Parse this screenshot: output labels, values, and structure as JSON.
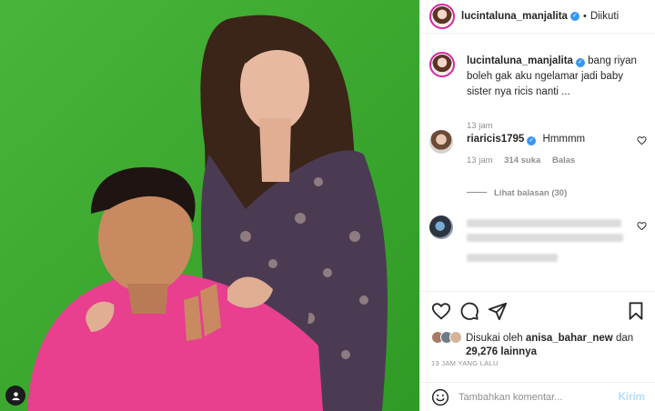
{
  "header": {
    "username": "lucintaluna_manjalita",
    "separator": "•",
    "follow_status": "Diikuti"
  },
  "caption": {
    "username": "lucintaluna_manjalita",
    "text": "bang riyan boleh gak aku ngelamar jadi baby sister nya ricis nanti ...",
    "time": "13 jam"
  },
  "comments": [
    {
      "username": "riaricis1795",
      "text": "Hmmmm",
      "time": "13 jam",
      "likes": "314 suka",
      "reply": "Balas",
      "view_replies": "Lihat balasan (30)"
    }
  ],
  "actions": {
    "liked_by_prefix": "Disukai oleh",
    "liked_by_user": "anisa_bahar_new",
    "liked_by_and": "dan",
    "liked_by_count": "29,276 lainnya",
    "timestamp": "13 JAM YANG LALU"
  },
  "add_comment": {
    "placeholder": "Tambahkan komentar...",
    "send_label": "Kirim"
  },
  "colors": {
    "backdrop": "#3fae2f",
    "verified": "#3897f0",
    "send_disabled": "#b2dffc",
    "story_ring": "#d6249f"
  }
}
